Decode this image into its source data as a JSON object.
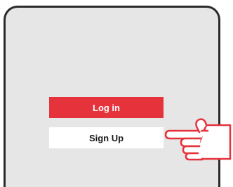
{
  "auth": {
    "login_label": "Log in",
    "signup_label": "Sign Up"
  },
  "pointer": {
    "icon": "pointing-hand-icon",
    "color": "#e6323b"
  },
  "colors": {
    "login_bg": "#e6323b",
    "screen_bg": "#e6e6e6",
    "frame": "#2b2b2b"
  }
}
